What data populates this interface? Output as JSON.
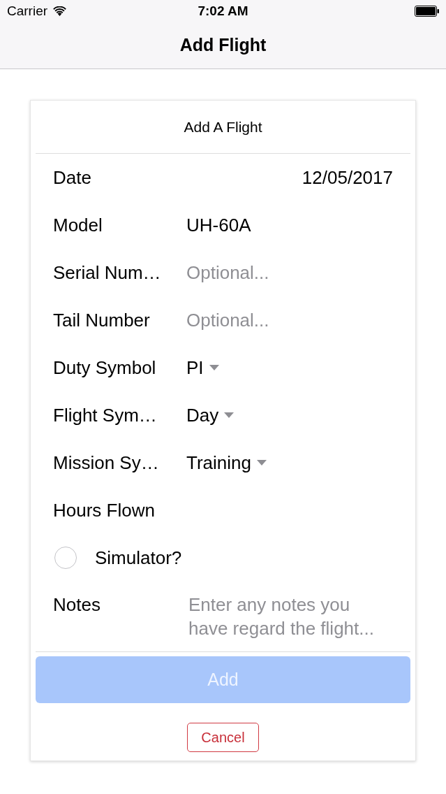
{
  "status_bar": {
    "carrier": "Carrier",
    "time": "7:02 AM"
  },
  "nav_bar": {
    "title": "Add Flight"
  },
  "form": {
    "title": "Add A Flight",
    "rows": [
      {
        "kind": "date",
        "label": "Date",
        "value": "12/05/2017"
      },
      {
        "kind": "text",
        "label": "Model",
        "value": "UH-60A"
      },
      {
        "kind": "text",
        "label": "Serial Num…",
        "placeholder": "Optional..."
      },
      {
        "kind": "text",
        "label": "Tail Number",
        "placeholder": "Optional..."
      },
      {
        "kind": "select",
        "label": "Duty Symbol",
        "value": "PI"
      },
      {
        "kind": "select",
        "label": "Flight Sym…",
        "value": "Day"
      },
      {
        "kind": "select",
        "label": "Mission Sy…",
        "value": "Training"
      },
      {
        "kind": "text",
        "label": "Hours Flown"
      },
      {
        "kind": "checkbox",
        "label": "Simulator?",
        "checked": false
      },
      {
        "kind": "textarea",
        "label": "Notes",
        "placeholder": "Enter any notes you have regard the flight..."
      }
    ],
    "buttons": [
      {
        "kind": "submit",
        "label": "Add",
        "disabled": true
      },
      {
        "kind": "cancel",
        "label": "Cancel"
      }
    ]
  }
}
